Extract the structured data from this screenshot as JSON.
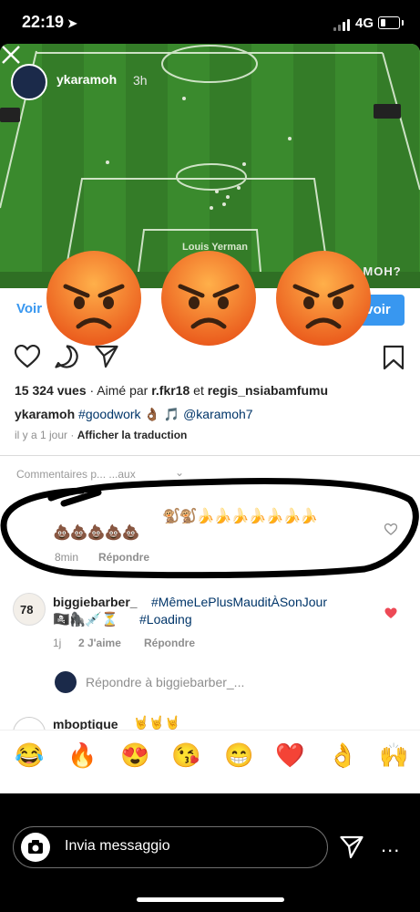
{
  "status_bar": {
    "time": "22:19",
    "network": "4G"
  },
  "story": {
    "username": "ykaramoh",
    "time_ago": "3h",
    "overlay_text": "AMOH?",
    "voir_left": "Voir",
    "voir_right": "voir",
    "angry_emoji_count": 3
  },
  "post": {
    "views_count": "15 324 vues",
    "liked_by_prefix": " · Aimé par ",
    "liked_by_1": "r.fkr18",
    "liked_by_and": " et ",
    "liked_by_2": "regis_nsiabamfumu",
    "caption_user": "ykaramoh",
    "caption_hashtag": "#goodwork",
    "caption_emojis": " 👌🏾 🎵 ",
    "caption_mention": "@karamoh7",
    "time_ago": "il y a 1 jour",
    "translate": "Afficher la traduction"
  },
  "comments": {
    "header": "Commentaires p... ...aux",
    "highlighted": {
      "emojis_line1": "🐒🐒🍌🍌🍌🍌🍌🍌🍌",
      "emojis_line2": "💩💩💩💩💩",
      "time": "8min",
      "reply": "Répondre"
    },
    "second": {
      "user": "biggiebarber_",
      "hashtag": "#MêmeLePlusMauditÀSonJour",
      "emojis": "🏴‍☠️🦍💉⏳",
      "hashtag2": "#Loading",
      "time": "1j",
      "likes": "2 J'aime",
      "reply": "Répondre",
      "avatar_number": "78",
      "liked_color": "#ed4956"
    },
    "reply_to": "Répondre à biggiebarber_...",
    "third": {
      "user": "mboptique",
      "emojis": "🤘🤘🤘"
    }
  },
  "emoji_bar": [
    "😂",
    "🔥",
    "😍",
    "😘",
    "😁",
    "❤️",
    "👌",
    "🙌"
  ],
  "message_bar": {
    "placeholder": "Invia messaggio",
    "more": "..."
  },
  "colors": {
    "link_blue": "#3897f0",
    "hashtag_navy": "#003569",
    "heart_red": "#ed4956",
    "pitch_green": "#3a8a2d"
  }
}
